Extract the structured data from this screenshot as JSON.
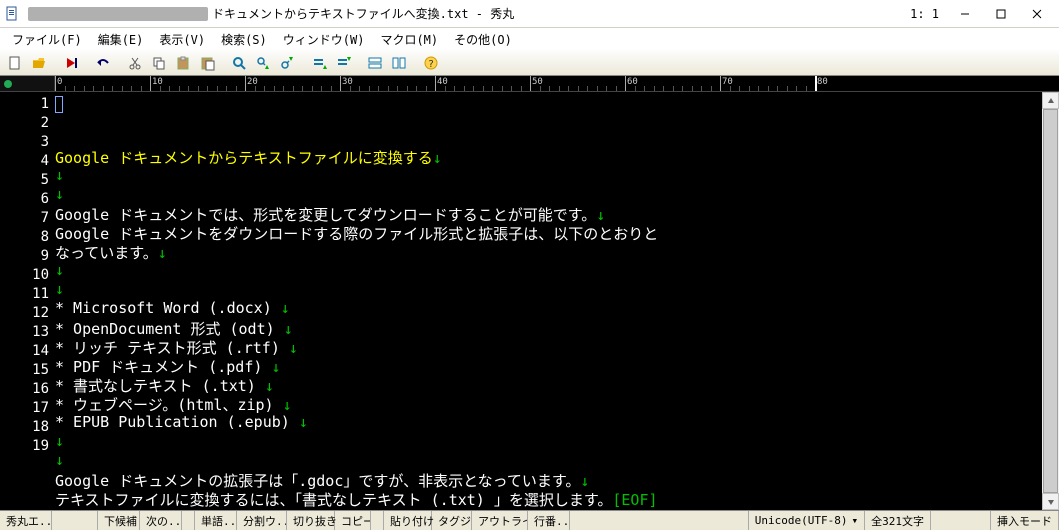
{
  "title": {
    "suffix": "ドキュメントからテキストファイルへ変換.txt - 秀丸",
    "cursor_pos": "1: 1"
  },
  "window_buttons": {
    "min": "—",
    "max": "▢",
    "close": "✕"
  },
  "menu": {
    "file": "ファイル(F)",
    "edit": "編集(E)",
    "view": "表示(V)",
    "search": "検索(S)",
    "window": "ウィンドウ(W)",
    "macro": "マクロ(M)",
    "other": "その他(O)"
  },
  "ruler": {
    "major_interval": 10,
    "end": 80
  },
  "content": {
    "lines": [
      {
        "n": 1,
        "text": "Google ドキュメントからテキストファイルに変換する",
        "cls": "line1",
        "nl": true
      },
      {
        "n": 2,
        "text": "",
        "nl": true
      },
      {
        "n": 3,
        "text": "",
        "nl": true
      },
      {
        "n": 4,
        "text": "Google ドキュメントでは、形式を変更してダウンロードすることが可能です。",
        "nl": true
      },
      {
        "n": 5,
        "text": "Google ドキュメントをダウンロードする際のファイル形式と拡張子は、以下のとおりと",
        "nl": false
      },
      {
        "n": 6,
        "text": "なっています。",
        "nl": true
      },
      {
        "n": 7,
        "text": "",
        "nl": true
      },
      {
        "n": 8,
        "text": "",
        "nl": true
      },
      {
        "n": 9,
        "text": "* Microsoft Word (.docx) ",
        "nl": true
      },
      {
        "n": 10,
        "text": "* OpenDocument 形式 (odt) ",
        "nl": true
      },
      {
        "n": 11,
        "text": "* リッチ テキスト形式 (.rtf) ",
        "nl": true
      },
      {
        "n": 12,
        "text": "* PDF ドキュメント (.pdf) ",
        "nl": true
      },
      {
        "n": 13,
        "text": "* 書式なしテキスト (.txt) ",
        "nl": true
      },
      {
        "n": 14,
        "text": "* ウェブページ。(html、zip) ",
        "nl": true
      },
      {
        "n": 15,
        "text": "* EPUB Publication (.epub) ",
        "nl": true
      },
      {
        "n": 16,
        "text": "",
        "nl": true
      },
      {
        "n": 17,
        "text": "",
        "nl": true
      },
      {
        "n": 18,
        "text": "Google ドキュメントの拡張子は「.gdoc」ですが、非表示となっています。",
        "nl": true
      },
      {
        "n": 19,
        "text": "テキストファイルに変換するには、「書式なしテキスト (.txt) 」を選択します。",
        "nl": false,
        "eof": true
      }
    ]
  },
  "status": {
    "app": "秀丸エ...",
    "kouho": "下候補",
    "next": "次の...",
    "tango": "単語...",
    "bunkatsu": "分割ウ...",
    "kirinuki": "切り抜き",
    "copy": "コピー",
    "paste": "貼り付け",
    "tagjump": "タグジ...",
    "outline": "アウトライ...",
    "gyouban": "行番...",
    "encoding": "Unicode(UTF-8)",
    "drop": "▾",
    "count": "全321文字",
    "mode": "挿入モード"
  }
}
